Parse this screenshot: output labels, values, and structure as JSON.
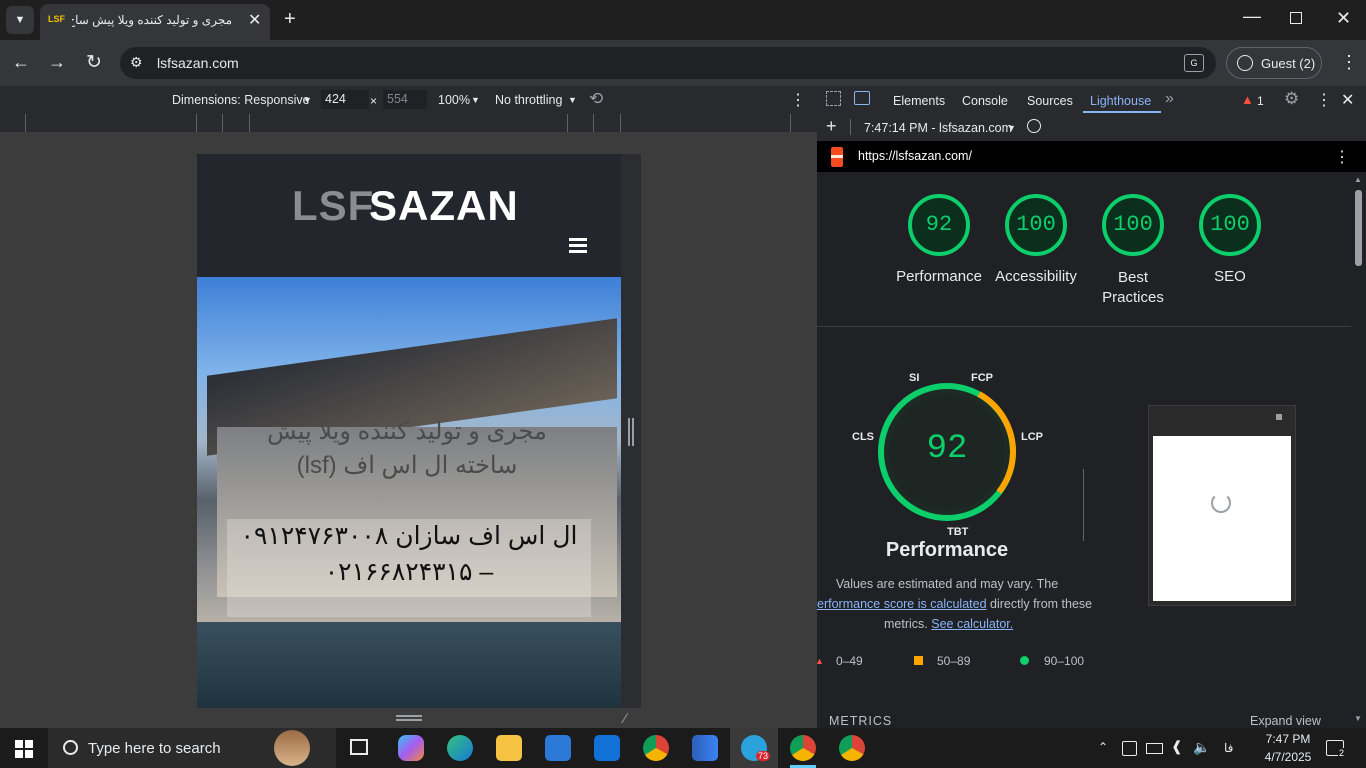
{
  "browser": {
    "tab_title": "مجری و تولید کننده ویلا پیش ساخ",
    "tab_favicon": "LSF",
    "url": "lsfsazan.com",
    "profile_label": "Guest (2)"
  },
  "device_toolbar": {
    "dimensions_label": "Dimensions: Responsive",
    "width": "424",
    "times": "×",
    "height_placeholder": "554",
    "zoom": "100%",
    "throttling": "No throttling"
  },
  "site": {
    "logo_lsf": "LSF",
    "logo_sazan": "SAZAN",
    "hero_title_line1": "مجری و تولید کننده ویلا پیش",
    "hero_title_line2": "ساخته ال اس اف (lsf)",
    "hero_phone_line1": "ال اس اف سازان ۰۹۱۲۴۷۶۳۰۰۸",
    "hero_phone_line2": "– ۰۲۱۶۶۸۲۴۳۱۵"
  },
  "devtools": {
    "tabs": [
      "Elements",
      "Console",
      "Sources",
      "Lighthouse"
    ],
    "active_tab": "Lighthouse",
    "issues_count": "1",
    "report_time": "7:47:14 PM - lsfsazan.com",
    "report_url": "https://lsfsazan.com/",
    "scores": [
      {
        "label": "Performance",
        "value": "92"
      },
      {
        "label": "Accessibility",
        "value": "100"
      },
      {
        "label": "Best Practices",
        "value": "100"
      },
      {
        "label": "SEO",
        "value": "100"
      }
    ],
    "perf_score": "92",
    "perf_title": "Performance",
    "metric_tags": {
      "si": "SI",
      "fcp": "FCP",
      "lcp": "LCP",
      "tbt": "TBT",
      "cls": "CLS"
    },
    "note_line1": "Values are estimated and may vary. The",
    "note_link": "erformance score is calculated",
    "note_line2_rest": " directly from these",
    "note_line3": "metrics.",
    "note_calc_link": "See calculator.",
    "legend": [
      {
        "range": "0–49",
        "color": "#ff4e42"
      },
      {
        "range": "50–89",
        "color": "#ffa400"
      },
      {
        "range": "90–100",
        "color": "#0cce6b"
      }
    ],
    "metrics_heading": "METRICS",
    "expand_view": "Expand view"
  },
  "taskbar": {
    "search_placeholder": "Type here to search",
    "lang": "فا",
    "time": "7:47 PM",
    "date": "4/7/2025",
    "notif_count": "2",
    "telegram_badge": "73"
  },
  "colors": {
    "good": "#0cce6b",
    "average": "#ffa400",
    "bad": "#ff4e42",
    "link": "#8ab4f8"
  }
}
